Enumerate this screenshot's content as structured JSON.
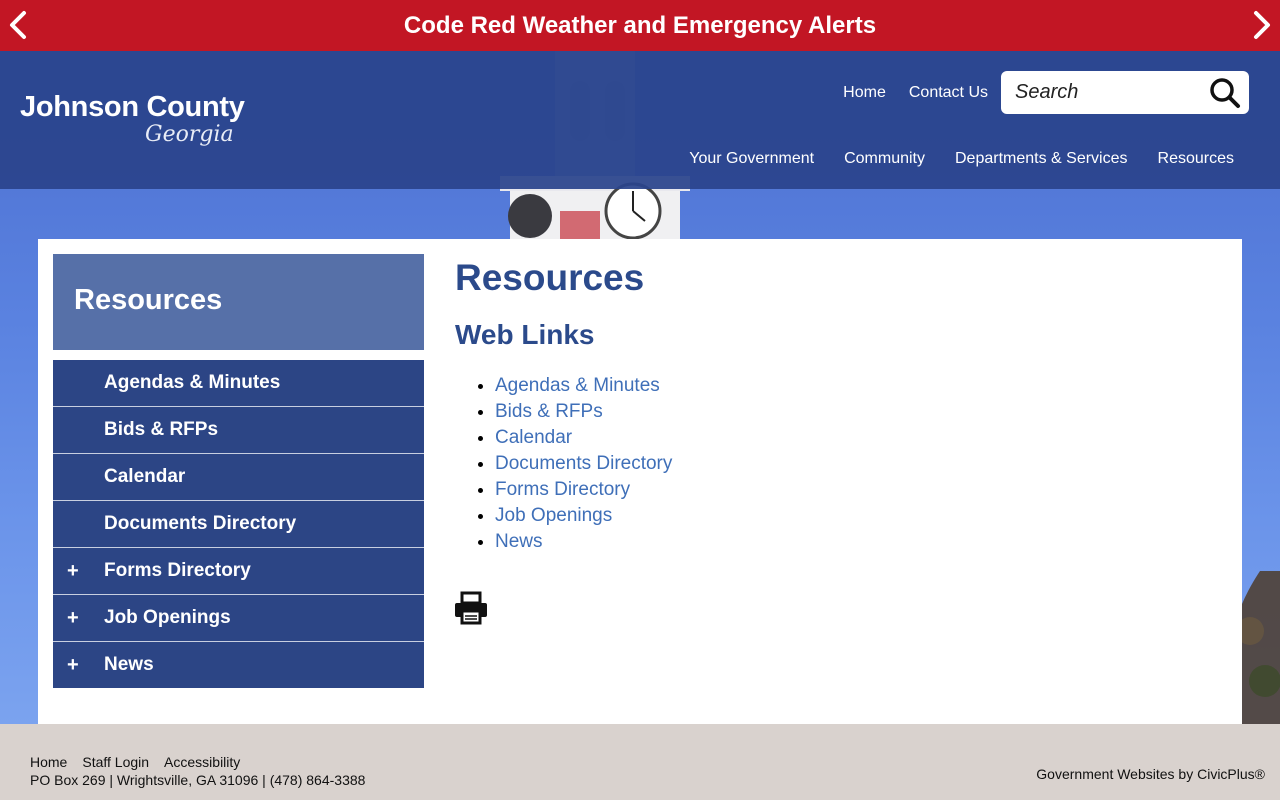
{
  "alert": {
    "text": "Code Red Weather and Emergency Alerts"
  },
  "logo": {
    "name": "Johnson County",
    "state": "Georgia"
  },
  "utility_nav": {
    "home": "Home",
    "contact": "Contact Us"
  },
  "search": {
    "placeholder": "Search"
  },
  "main_nav": {
    "items": [
      "Your Government",
      "Community",
      "Departments & Services",
      "Resources"
    ]
  },
  "sidebar": {
    "title": "Resources",
    "items": [
      {
        "label": "Agendas & Minutes",
        "expand": ""
      },
      {
        "label": "Bids & RFPs",
        "expand": ""
      },
      {
        "label": "Calendar",
        "expand": ""
      },
      {
        "label": "Documents Directory",
        "expand": ""
      },
      {
        "label": "Forms Directory",
        "expand": "+"
      },
      {
        "label": "Job Openings",
        "expand": "+"
      },
      {
        "label": "News",
        "expand": "+"
      }
    ]
  },
  "main": {
    "title": "Resources",
    "section_title": "Web Links",
    "links": [
      "Agendas & Minutes",
      "Bids & RFPs",
      "Calendar",
      "Documents Directory",
      "Forms Directory",
      "Job Openings",
      "News"
    ]
  },
  "footer": {
    "links": [
      "Home",
      "Staff Login",
      "Accessibility"
    ],
    "address": "PO Box 269 | Wrightsville, GA 31096 | (478) 864-3388",
    "credit": "Government Websites by CivicPlus®"
  },
  "colors": {
    "alert_red": "#c21624",
    "header_blue": "#2a448c",
    "sidebar_blue": "#2c4585",
    "sidebar_title_blue": "#5670a8",
    "heading_blue": "#2b4a8b",
    "link_blue": "#3f6fb8",
    "footer_bg": "#d9d2ce"
  }
}
